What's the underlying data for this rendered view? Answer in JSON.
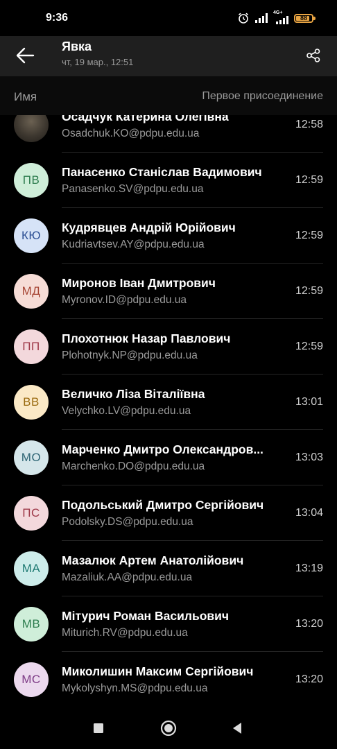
{
  "status_bar": {
    "time": "9:36",
    "network": "4G+",
    "battery": "88",
    "battery_level": 0.88,
    "icons": [
      "alarm-icon",
      "signal-icon",
      "signal-4g-icon",
      "battery-icon"
    ]
  },
  "header": {
    "title": "Явка",
    "subtitle": "чт, 19 мар., 12:51",
    "back_icon": "arrow-left-icon",
    "share_icon": "share-icon"
  },
  "columns": {
    "name": "Имя",
    "joined": "Первое присоединение"
  },
  "participants": [
    {
      "initials": "",
      "photo": true,
      "name": "Осадчук Катерина Олегівна",
      "email": "Osadchuk.KO@pdpu.edu.ua",
      "time": "12:58",
      "bg": "#3d372f",
      "fg": "#ffffff"
    },
    {
      "initials": "ПВ",
      "name": "Панасенко Станіслав Вадимович",
      "email": "Panasenko.SV@pdpu.edu.ua",
      "time": "12:59",
      "bg": "#cfeed9",
      "fg": "#2e7d4f"
    },
    {
      "initials": "КЮ",
      "name": "Кудрявцев Андрій Юрійович",
      "email": "Kudriavtsev.AY@pdpu.edu.ua",
      "time": "12:59",
      "bg": "#d6e3f7",
      "fg": "#2c4f94"
    },
    {
      "initials": "МД",
      "name": "Миронов Іван Дмитрович",
      "email": "Myronov.ID@pdpu.edu.ua",
      "time": "12:59",
      "bg": "#f6dcd6",
      "fg": "#a64534"
    },
    {
      "initials": "ПП",
      "name": "Плохотнюк Назар Павлович",
      "email": "Plohotnyk.NP@pdpu.edu.ua",
      "time": "12:59",
      "bg": "#f3d8dc",
      "fg": "#9e3848"
    },
    {
      "initials": "ВВ",
      "name": "Величко Ліза Віталіївна",
      "email": "Velychko.LV@pdpu.edu.ua",
      "time": "13:01",
      "bg": "#fbe9c6",
      "fg": "#9a6a0e"
    },
    {
      "initials": "МО",
      "name": "Марченко Дмитро Олександров...",
      "email": "Marchenko.DO@pdpu.edu.ua",
      "time": "13:03",
      "bg": "#d5e6ea",
      "fg": "#2e6574"
    },
    {
      "initials": "ПС",
      "name": "Подольський Дмитро Сергійович",
      "email": "Podolsky.DS@pdpu.edu.ua",
      "time": "13:04",
      "bg": "#f3d8dc",
      "fg": "#9e3848"
    },
    {
      "initials": "МА",
      "name": "Мазалюк Артем Анатолійович",
      "email": "Mazaliuk.AA@pdpu.edu.ua",
      "time": "13:19",
      "bg": "#cdecea",
      "fg": "#1f7a73"
    },
    {
      "initials": "МВ",
      "name": "Мітурич Роман Васильович",
      "email": "Miturich.RV@pdpu.edu.ua",
      "time": "13:20",
      "bg": "#cfeed9",
      "fg": "#2e7d4f"
    },
    {
      "initials": "МС",
      "name": "Миколишин Максим Сергійович",
      "email": "Mykolyshyn.MS@pdpu.edu.ua",
      "time": "13:20",
      "bg": "#ecd9ee",
      "fg": "#7e3b86"
    }
  ],
  "nav": {
    "recent_icon": "square-icon",
    "home_icon": "circle-home-icon",
    "back_icon": "triangle-back-icon"
  },
  "colors": {
    "background": "#000000",
    "appbar": "#1f1f1f",
    "secondary_text": "#9a9a9a",
    "battery": "#e8a443"
  }
}
